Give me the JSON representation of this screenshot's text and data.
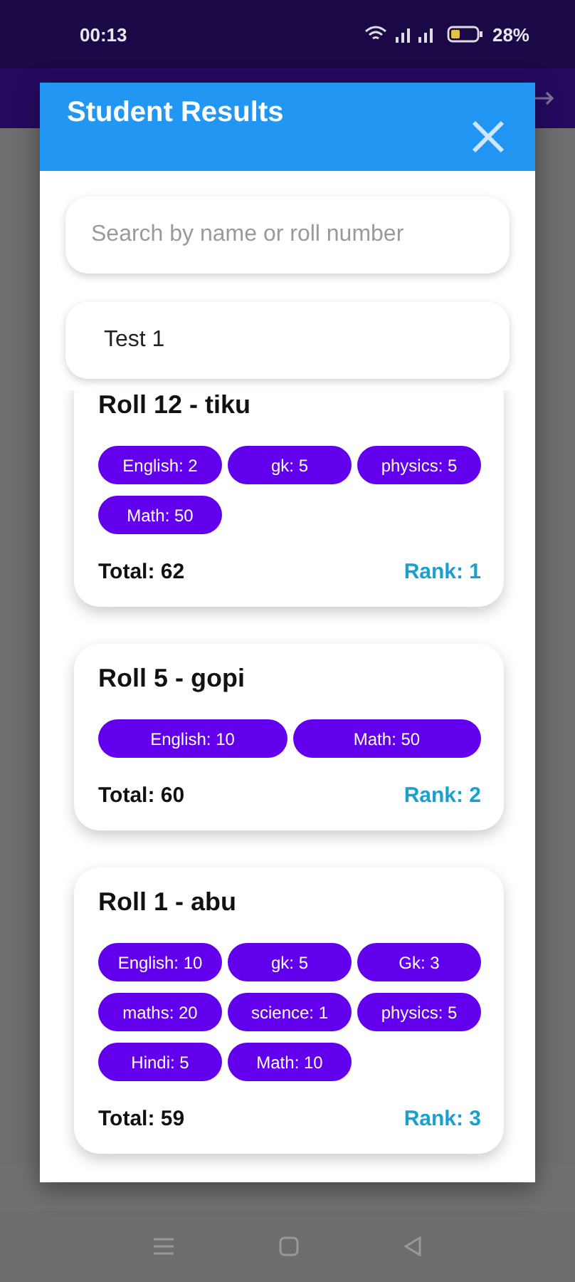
{
  "status_bar": {
    "time": "00:13",
    "battery": "28%"
  },
  "dialog": {
    "title": "Student Results",
    "search": {
      "placeholder": "Search by name or roll number"
    },
    "test_select": {
      "value": "Test 1"
    },
    "results": [
      {
        "heading": "Roll 12 - tiku",
        "scores": [
          "English: 2",
          "gk: 5",
          "physics: 5",
          "Math: 50"
        ],
        "total": "Total: 62",
        "rank": "Rank: 1"
      },
      {
        "heading": "Roll 5 - gopi",
        "scores": [
          "English: 10",
          "Math: 50"
        ],
        "total": "Total: 60",
        "rank": "Rank: 2"
      },
      {
        "heading": "Roll 1 - abu",
        "scores": [
          "English: 10",
          "gk: 5",
          "Gk: 3",
          "maths: 20",
          "science: 1",
          "physics: 5",
          "Hindi: 5",
          "Math: 10"
        ],
        "total": "Total: 59",
        "rank": "Rank: 3"
      }
    ]
  }
}
